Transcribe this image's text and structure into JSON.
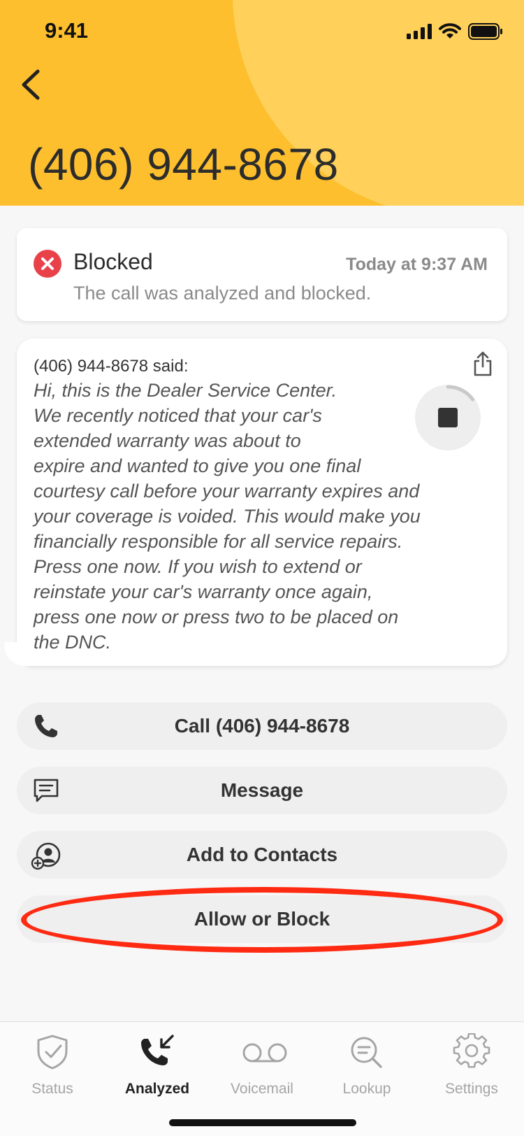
{
  "status_bar": {
    "time": "9:41"
  },
  "header": {
    "phone_number": "(406) 944-8678"
  },
  "status_card": {
    "title": "Blocked",
    "timestamp": "Today at 9:37 AM",
    "description": "The call was analyzed and blocked."
  },
  "transcript": {
    "speaker": "(406) 944-8678 said:",
    "lines": [
      "Hi, this is the Dealer Service Center.",
      "We recently noticed that your car's",
      "extended warranty was about to",
      "expire and wanted to give you one final",
      "courtesy call before your warranty expires and",
      "your coverage is voided. This would make you",
      "financially responsible for all service repairs.",
      "Press one now. If you wish to extend or",
      "reinstate your car's warranty once again,",
      "press one now or press two to be placed on",
      "the DNC."
    ],
    "playback_progress": 0.15
  },
  "actions": {
    "call": "Call (406) 944-8678",
    "message": "Message",
    "add_contact": "Add to Contacts",
    "allow_block": "Allow or Block"
  },
  "tabs": [
    {
      "label": "Status",
      "icon": "shield-check-icon"
    },
    {
      "label": "Analyzed",
      "icon": "incoming-call-icon"
    },
    {
      "label": "Voicemail",
      "icon": "voicemail-icon"
    },
    {
      "label": "Lookup",
      "icon": "search-icon"
    },
    {
      "label": "Settings",
      "icon": "gear-icon"
    }
  ],
  "colors": {
    "header": "#fdbf2d",
    "header_circle": "#ffd15a",
    "blocked_red": "#e9414a",
    "highlight_red": "#ff2a12"
  }
}
